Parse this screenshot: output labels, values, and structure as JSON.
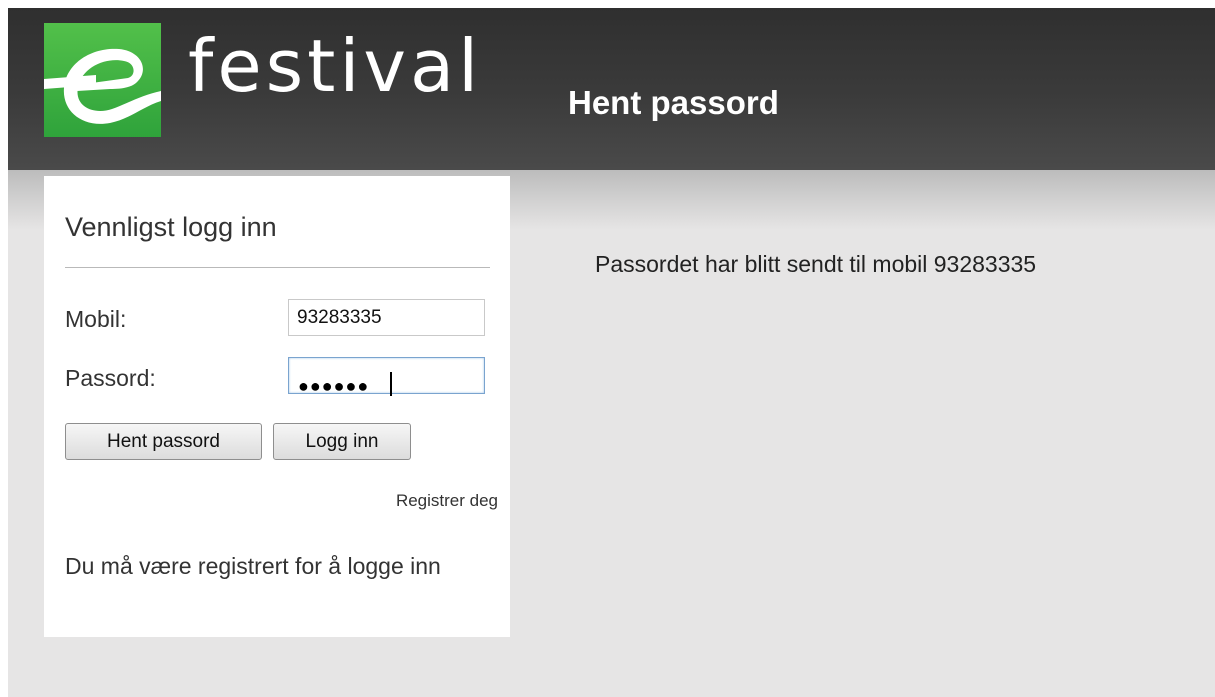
{
  "header": {
    "logo_letter": "e",
    "brand_name": "festival",
    "page_title": "Hent passord",
    "colors": {
      "header_bg": "#333333",
      "logo_green": "#3ab241"
    }
  },
  "login": {
    "heading": "Vennligst logg inn",
    "mobile_label": "Mobil:",
    "mobile_value": "93283335",
    "password_label": "Passord:",
    "password_masked": "●●●●●●",
    "retrieve_button": "Hent passord",
    "login_button": "Logg inn",
    "register_link": "Registrer deg",
    "note": "Du må være registrert for å logge inn"
  },
  "main": {
    "message": "Passordet har blitt sendt til mobil 93283335"
  }
}
